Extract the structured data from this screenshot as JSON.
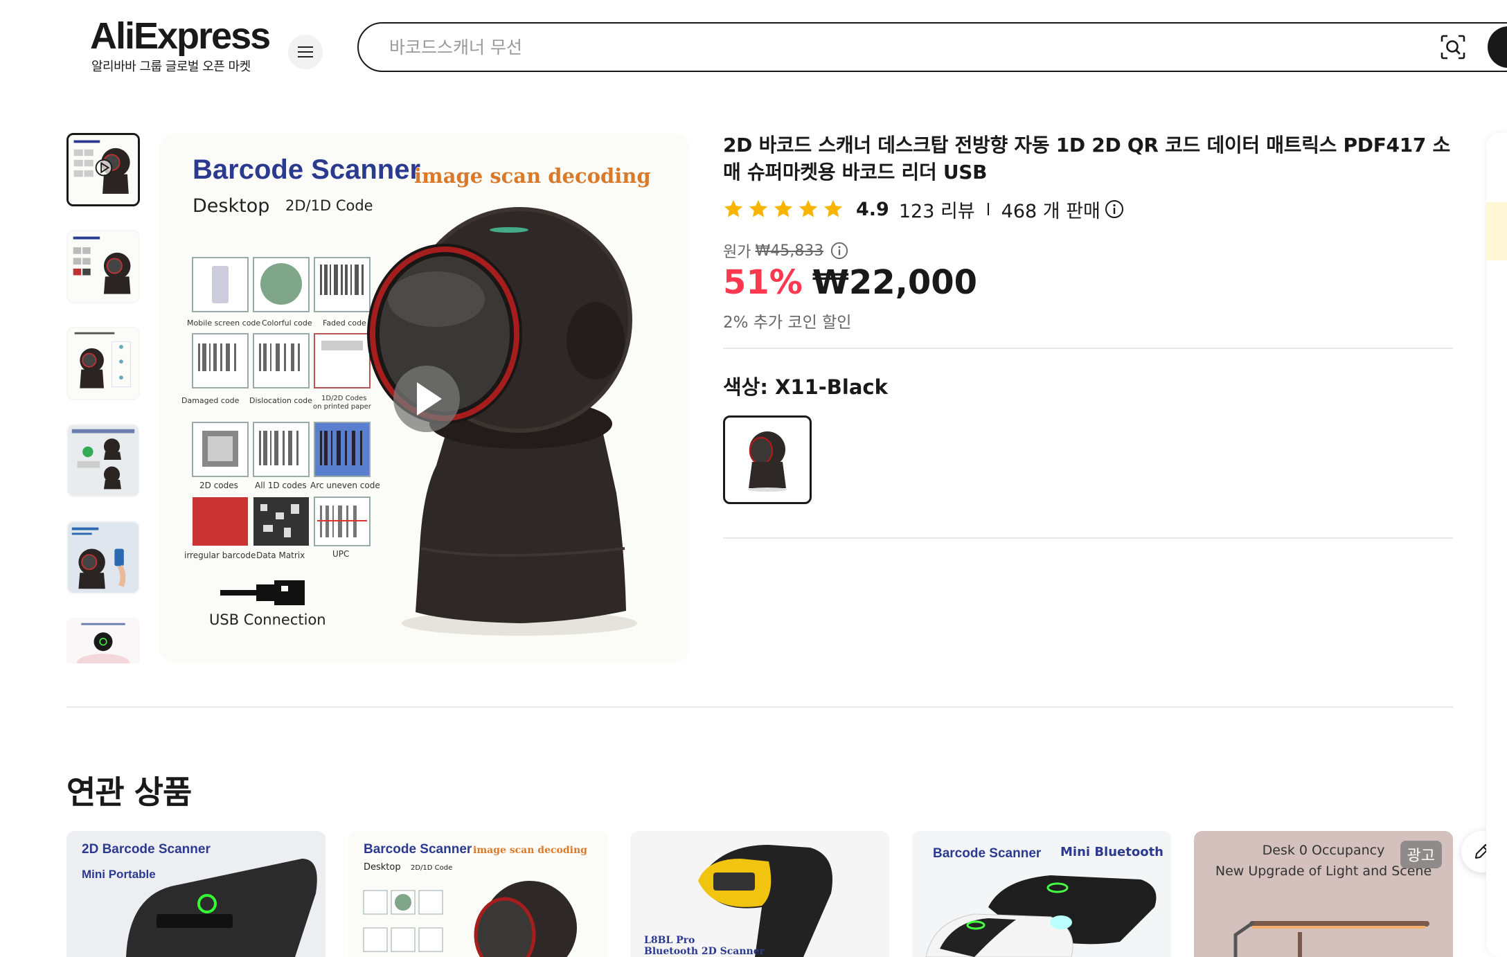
{
  "header": {
    "logo_text": "AliExpress",
    "logo_tagline": "알리바바 그룹 글로벌 오픈 마켓",
    "search_placeholder": "바코드스캐너 무선"
  },
  "gallery": {
    "thumb_count": 6,
    "main_image": {
      "title": "Barcode Scanner",
      "subtitle_left": "Desktop",
      "subtitle_right": "2D/1D Code",
      "tagline": "image scan decoding",
      "labels": [
        "Mobile screen code",
        "Colorful code",
        "Faded code",
        "Damaged code",
        "Dislocation code",
        "1D/2D Codes",
        "on printed paper",
        "2D codes",
        "All 1D codes",
        "Arc uneven code",
        "irregular barcode",
        "Data Matrix",
        "UPC"
      ],
      "usb_label": "USB Connection"
    }
  },
  "product": {
    "title": "2D 바코드 스캐너 데스크탑 전방향 자동 1D 2D QR 코드 데이터 매트릭스 PDF417 소매 슈퍼마켓용 바코드 리더 USB",
    "rating": "4.9",
    "reviews": "123 리뷰",
    "sold": "468 개 판매",
    "original_label": "원가",
    "original_price": "₩45,833",
    "discount": "51%",
    "price": "₩22,000",
    "coin_discount": "2% 추가 코인 할인",
    "color_label": "색상: X11-Black"
  },
  "related": {
    "title": "연관 상품",
    "cards": [
      {
        "line1": "2D Barcode Scanner",
        "line2": "Mini Portable"
      },
      {
        "line1": "Barcode Scanner",
        "line2": "image scan decoding",
        "line3": "Desktop",
        "line4": "2D/1D Code"
      },
      {
        "line1": "L8BL Pro",
        "line2": "Bluetooth 2D Scanner"
      },
      {
        "line1": "Barcode Scanner",
        "line2": "Mini Bluetooth"
      },
      {
        "line1": "Desk 0 Occupancy",
        "line2": "New Upgrade of Light and Scene",
        "badge": "광고"
      }
    ]
  },
  "colors": {
    "accent": "#fd384f",
    "star": "#f7b500",
    "dark": "#191919"
  }
}
